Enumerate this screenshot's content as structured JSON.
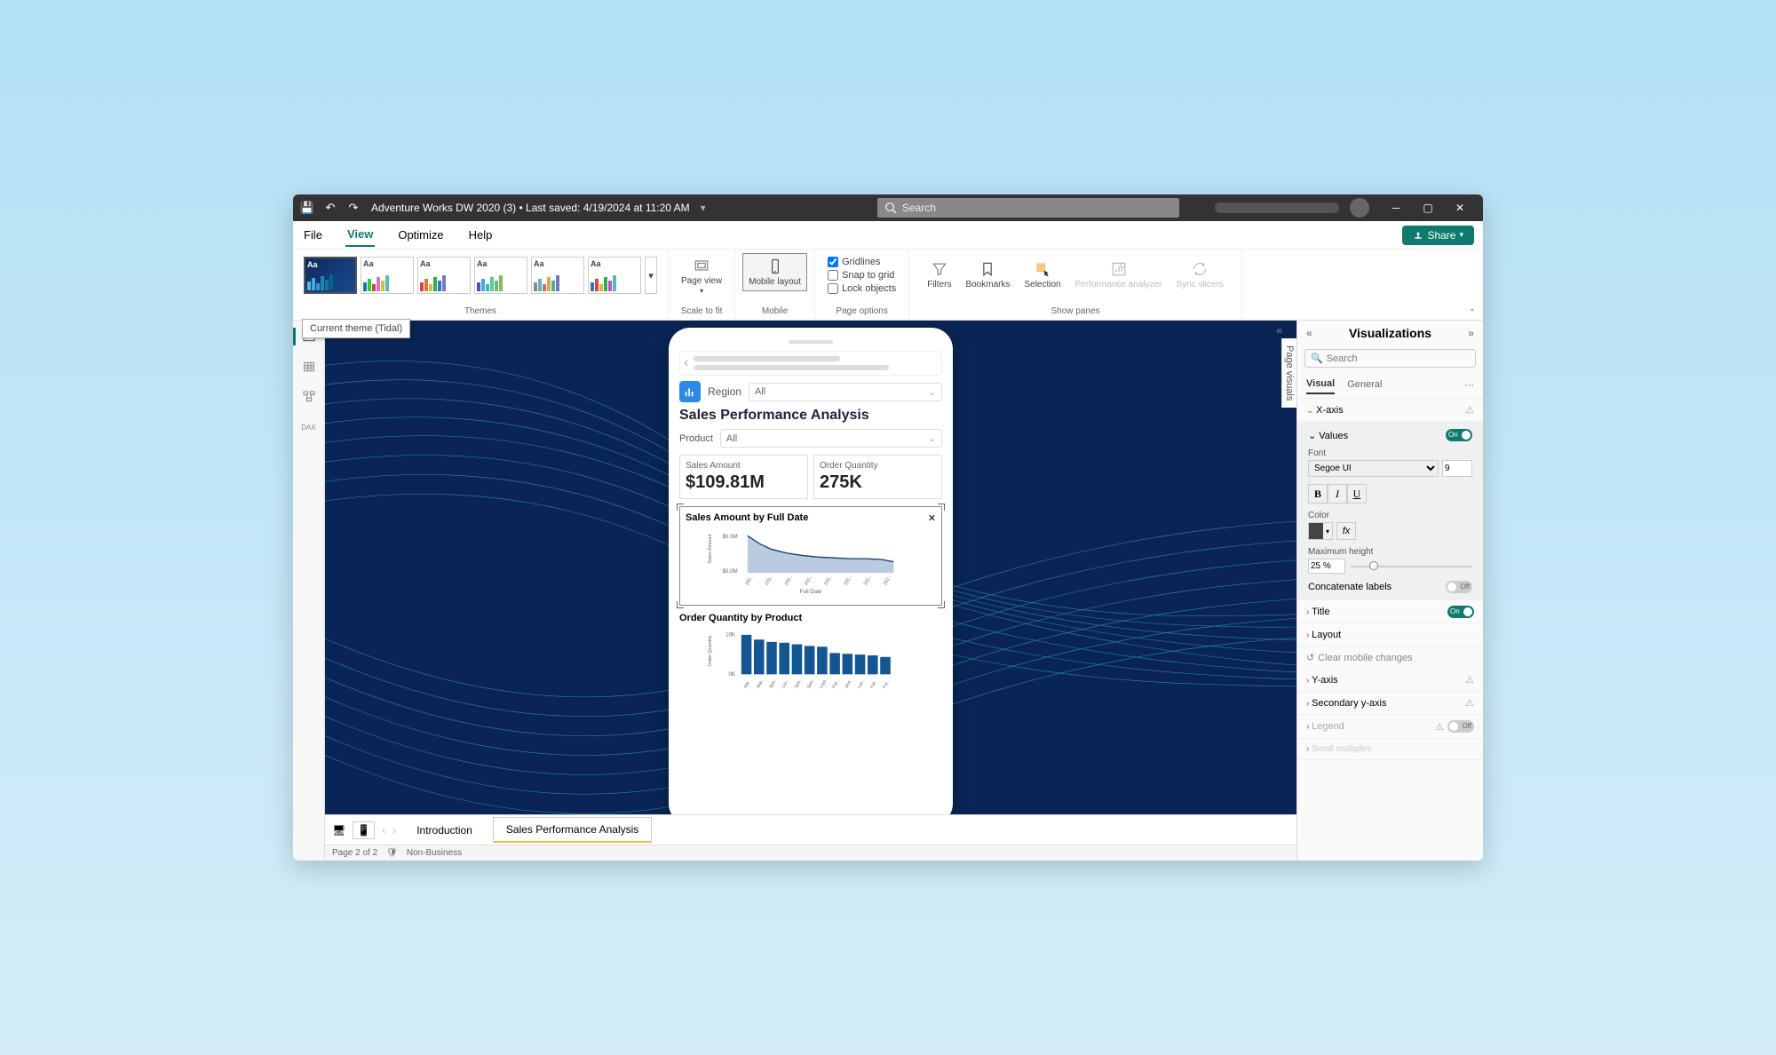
{
  "titlebar": {
    "file_title": "Adventure Works DW 2020 (3)",
    "saved_label": "Last saved: 4/19/2024 at 11:20 AM",
    "search_placeholder": "Search"
  },
  "menubar": {
    "file": "File",
    "view": "View",
    "optimize": "Optimize",
    "help": "Help",
    "share": "Share"
  },
  "ribbon": {
    "themes_label": "Themes",
    "scale_label": "Scale to fit",
    "page_view": "Page view",
    "mobile_label": "Mobile",
    "mobile_layout": "Mobile layout",
    "page_options": "Page options",
    "gridlines": "Gridlines",
    "snap": "Snap to grid",
    "lock": "Lock objects",
    "show_panes": "Show panes",
    "filters": "Filters",
    "bookmarks": "Bookmarks",
    "selection": "Selection",
    "perf": "Performance analyzer",
    "sync": "Sync slicers",
    "tooltip": "Current theme (Tidal)"
  },
  "phone": {
    "region_label": "Region",
    "region_value": "All",
    "title": "Sales Performance Analysis",
    "product_label": "Product",
    "product_value": "All",
    "card1_title": "Sales Amount",
    "card1_value": "$109.81M",
    "card2_title": "Order Quantity",
    "card2_value": "275K",
    "chart1_title": "Sales Amount by Full Date",
    "chart1_xlabel": "Full Date",
    "chart2_title": "Order Quantity by Product"
  },
  "chart_data": [
    {
      "type": "area",
      "title": "Sales Amount by Full Date",
      "ylabel": "Sales Amount",
      "xlabel": "Full Date",
      "y_ticks": [
        "$0.5M",
        "$0.0M"
      ],
      "x_ticks": [
        "202...",
        "201...",
        "201...",
        "201...",
        "201...",
        "201...",
        "201...",
        "201..."
      ],
      "values": [
        0.5,
        0.4,
        0.36,
        0.34,
        0.33,
        0.32,
        0.31,
        0.3,
        0.3,
        0.3,
        0.29,
        0.25
      ]
    },
    {
      "type": "bar",
      "title": "Order Quantity by Product",
      "ylabel": "Order Quantity",
      "y_ticks": [
        "10K",
        "0K"
      ],
      "categories": [
        "AW...",
        "Wat...",
        "Spo...",
        "Lon...",
        "Spo...",
        "Spo...",
        "Clas...",
        "Pat...",
        "Sho...",
        "Lon...",
        "Hal...",
        "Ful..."
      ],
      "values": [
        9.5,
        8.5,
        8.0,
        7.8,
        7.5,
        7.2,
        7.0,
        5.5,
        5.2,
        5.0,
        4.8,
        4.5
      ]
    }
  ],
  "pagebar": {
    "intro": "Introduction",
    "sales": "Sales Performance Analysis"
  },
  "statusbar": {
    "page": "Page 2 of 2",
    "class": "Non-Business"
  },
  "right_pane": {
    "header": "Visualizations",
    "page_visuals": "Page visuals",
    "search": "Search",
    "tabs": {
      "visual": "Visual",
      "general": "General"
    },
    "xaxis": "X-axis",
    "values": "Values",
    "font_label": "Font",
    "font": "Segoe UI",
    "font_size": "9",
    "color_label": "Color",
    "max_height_label": "Maximum height",
    "max_height": "25 %",
    "concat": "Concatenate labels",
    "title": "Title",
    "layout": "Layout",
    "clear": "Clear mobile changes",
    "yaxis": "Y-axis",
    "secondary": "Secondary y-axis",
    "legend": "Legend",
    "small": "Small multiples"
  }
}
